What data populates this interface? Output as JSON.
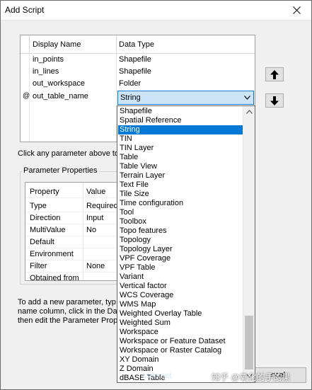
{
  "window": {
    "title": "Add Script"
  },
  "grid": {
    "headers": {
      "display_name": "Display Name",
      "data_type": "Data Type"
    },
    "rows": [
      {
        "name": "in_points",
        "type": "Shapefile"
      },
      {
        "name": "in_lines",
        "type": "Shapefile"
      },
      {
        "name": "out_workspace",
        "type": "Folder"
      },
      {
        "name": "out_table_name",
        "type": "String"
      }
    ],
    "current_row_marker": "@"
  },
  "hints": {
    "click_param": "Click any parameter above to",
    "add_line1": "To add a new parameter, typ",
    "add_line2": "name column, click in the Data",
    "add_line3": "then edit the Parameter Prop"
  },
  "parameter_properties": {
    "title": "Parameter Properties",
    "headers": {
      "property": "Property",
      "value": "Value"
    },
    "rows": [
      {
        "property": "Type",
        "value": "Required"
      },
      {
        "property": "Direction",
        "value": "Input"
      },
      {
        "property": "MultiValue",
        "value": "No"
      },
      {
        "property": "Default",
        "value": ""
      },
      {
        "property": "Environment",
        "value": ""
      },
      {
        "property": "Filter",
        "value": "None"
      },
      {
        "property": "Obtained from",
        "value": ""
      }
    ]
  },
  "dropdown": {
    "selected": "String",
    "items": [
      "Shapefile",
      "Spatial Reference",
      "String",
      "TIN",
      "TIN Layer",
      "Table",
      "Table View",
      "Terrain Layer",
      "Text File",
      "Tile Size",
      "Time configuration",
      "Tool",
      "Toolbox",
      "Topo features",
      "Topology",
      "Topology Layer",
      "VPF Coverage",
      "VPF Table",
      "Variant",
      "Vertical factor",
      "WCS Coverage",
      "WMS Map",
      "Weighted Overlay Table",
      "Weighted Sum",
      "Workspace",
      "Workspace or Feature Dataset",
      "Workspace or Raster Catalog",
      "XY Domain",
      "Z Domain",
      "dBASE Table"
    ]
  },
  "buttons": {
    "cancel": "ncel"
  },
  "watermark": {
    "text": "知乎 @氧化的手的果",
    "url": "csdn.net"
  }
}
